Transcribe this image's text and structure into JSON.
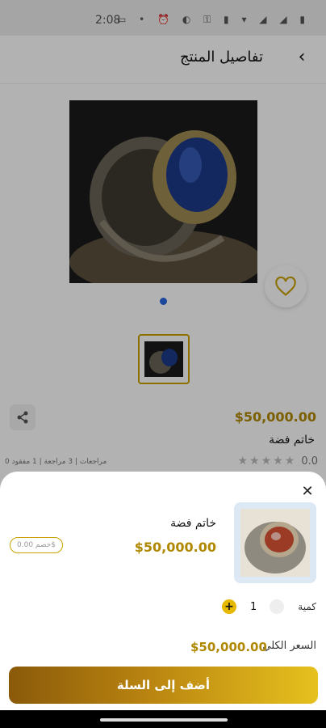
{
  "status_bar": {
    "time": "2:08",
    "icons": [
      "monitor-icon",
      "dot-icon",
      "alarm-icon",
      "hotspot-icon",
      "key-icon",
      "vibrate-icon",
      "wifi-icon",
      "signal-icon",
      "signal-icon",
      "battery-icon"
    ]
  },
  "app_bar": {
    "title": "تفاصيل المنتج",
    "back_icon": "chevron-left-icon"
  },
  "product": {
    "price": "$50,000.00",
    "name": "خاتم فضة",
    "rating_value": "0.0",
    "rating_meta": "0 مراجعات | 3 مراجعة | 1 مفقود",
    "favorite_icon": "heart-outline-icon",
    "share_icon": "share-icon"
  },
  "sheet": {
    "name": "خاتم فضة",
    "price": "$50,000.00",
    "discount_pill": "خصم 0.00$",
    "quantity_label": "كمية",
    "quantity_value": "1",
    "total_label": "السعر الكلي",
    "total_value": "$50,000.00",
    "add_to_cart": "أضف إلى السلة"
  },
  "colors": {
    "accent_gold": "#b08800",
    "button_gradient_start": "#8a5a0a",
    "button_gradient_end": "#e6c11e",
    "dot_active": "#2766e0"
  }
}
